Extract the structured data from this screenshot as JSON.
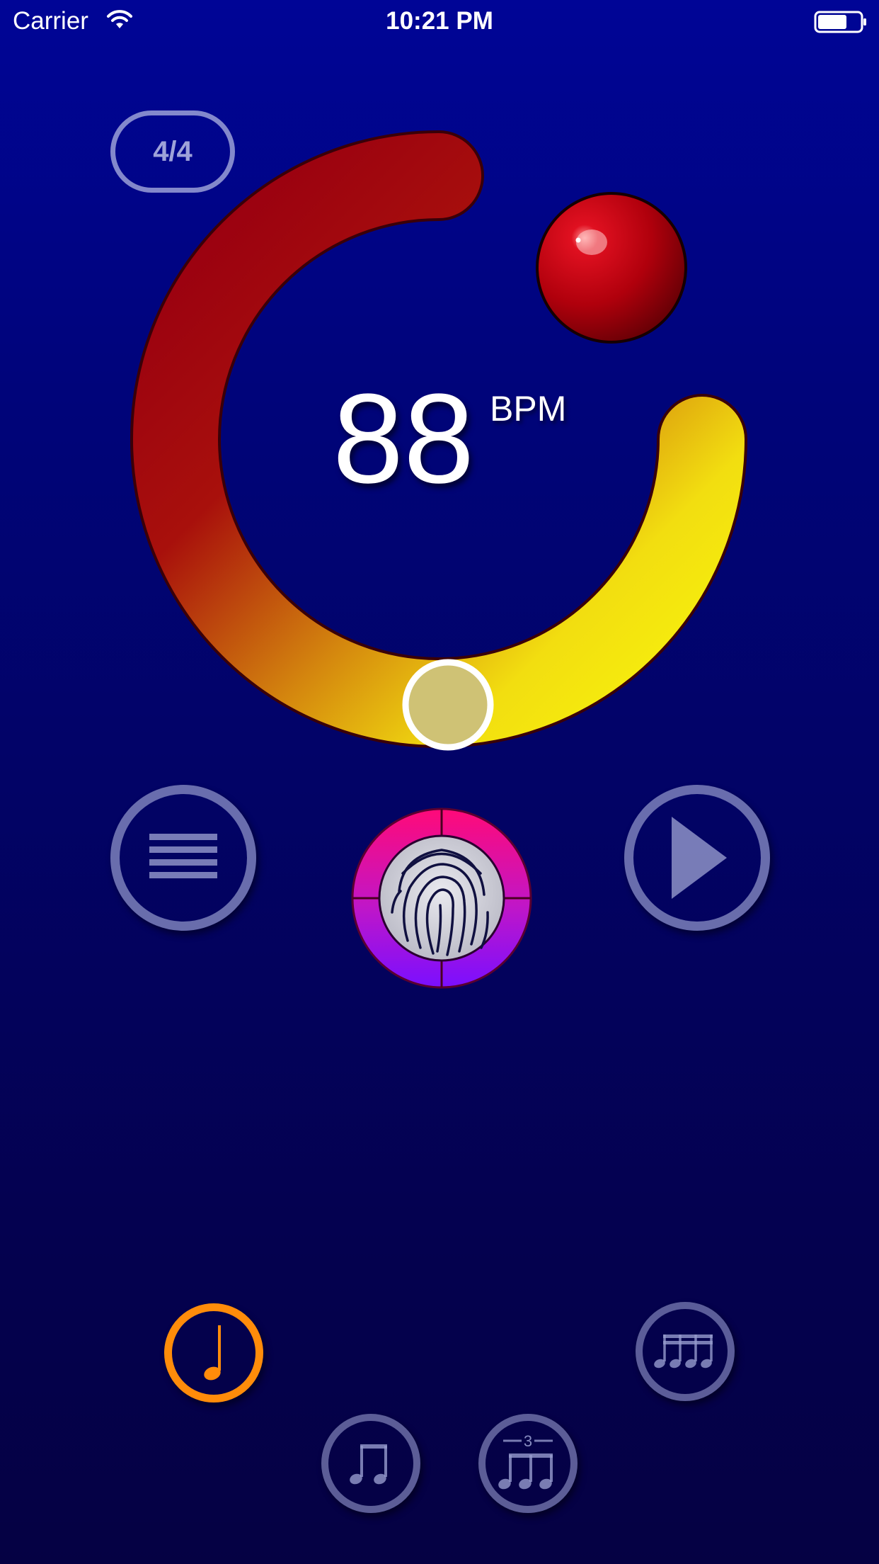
{
  "status_bar": {
    "carrier": "Carrier",
    "time": "10:21 PM",
    "wifi_icon": "wifi-icon",
    "battery_icon": "battery-icon"
  },
  "time_signature": {
    "label": "4/4"
  },
  "tempo": {
    "value": "88",
    "unit": "BPM"
  },
  "dial": {
    "gradient_start": "#9a0010",
    "gradient_mid": "#d4860e",
    "gradient_end": "#f7f20c",
    "knob_fill": "#cfc275",
    "indicator_color": "#c0000a"
  },
  "controls": {
    "menu_icon": "hamburger-menu-icon",
    "play_icon": "play-icon",
    "tap_icon": "fingerprint-icon",
    "tap_ring_top": "#ff0a78",
    "tap_ring_bottom": "#7a0fff"
  },
  "subdivisions": {
    "selected": "quarter",
    "selected_color": "#ff8c0a",
    "items": [
      {
        "id": "quarter",
        "icon": "quarter-note-icon"
      },
      {
        "id": "eighth",
        "icon": "eighth-notes-icon"
      },
      {
        "id": "triplet",
        "icon": "triplet-notes-icon",
        "label": "3"
      },
      {
        "id": "sixteenth",
        "icon": "sixteenth-notes-icon"
      }
    ]
  }
}
